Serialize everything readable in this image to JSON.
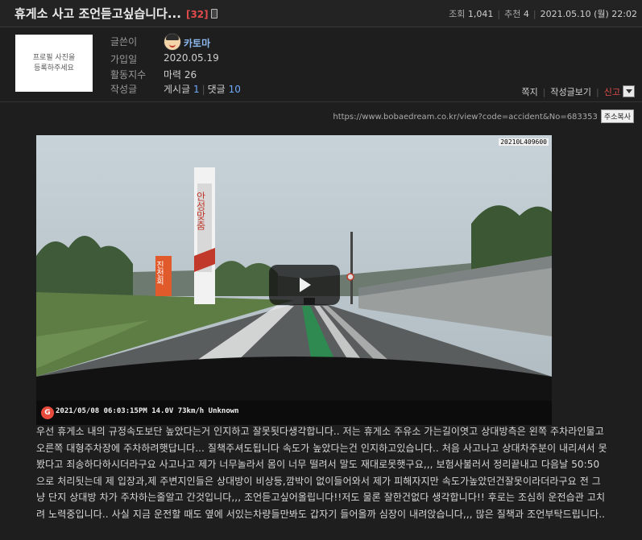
{
  "post": {
    "title": "휴게소 사고 조언듣고싶습니다...",
    "comment_count": "[32]",
    "views_label": "조회",
    "views": "1,041",
    "recommend_label": "추천",
    "recommend": "4",
    "date": "2021.05.10 (월) 22:02"
  },
  "profile": {
    "photo_placeholder_line1": "프로필 사진을",
    "photo_placeholder_line2": "등록하주세요",
    "author_label": "글쓴이",
    "author": "카토마",
    "joined_label": "가입일",
    "joined": "2020.05.19",
    "activity_label": "활동지수",
    "activity": "마력 26",
    "posts_label": "작성글",
    "posts_prefix": "게시글",
    "posts_count": "1",
    "comments_prefix": "댓글",
    "comments_count": "10"
  },
  "actions": {
    "message": "쪽지",
    "view_posts": "작성글보기",
    "report": "신고"
  },
  "url": {
    "text": "https://www.bobaedream.co.kr/view?code=accident&No=683353",
    "copy_label": "주소복사"
  },
  "video": {
    "top_stamp": "20210L409600",
    "overlay_logo": "G",
    "overlay_text": "2021/05/08 06:03:15PM 14.0V    73km/h Unknown",
    "sign_text": "안성맞춤",
    "shop_sign_text": "진천회",
    "icons": [
      "play-icon"
    ]
  },
  "content": {
    "body": "우선 휴게소 내의 규정속도보단 높았다는거 인지하고 잘못됫다생각합니다.. 저는 휴게소 주유소 가는길이엿고 상대방측은 왼쪽 주차라인물고 오른쪽 대형주차장에 주차하려햇답니다... 질책주셔도됩니다 속도가 높았다는건 인지하고있습니다.. 처음 사고나고 상대차주분이 내리셔서 못봤다고 죄송하다하시더라구요 사고나고 제가 너무놀라서 몸이 너무 떨려서 말도 재대로못햇구요,,, 보험사불러서 정리끝내고 다음날 50:50 으로 처리됫는데 제 입장과,제 주변지인들은 상대방이 비상등,깜박이 없이들어와서 제가 피해자지만 속도가높았던건잘못이라더라구요 전 그냥 단지 상대방 차가 주차하는줄알고 간것입니다,,, 조언듣고싶어올립니다!!저도 물론 잘한건없다 생각합니다!! 후로는 조심히 운전습관 고치려 노력중입니다.. 사실 지금 운전할 때도 옆에 서있는차량들만봐도 갑자기 들어올까 심장이 내려앉습니다,,, 많은 질책과 조언부탁드립니다.."
  }
}
